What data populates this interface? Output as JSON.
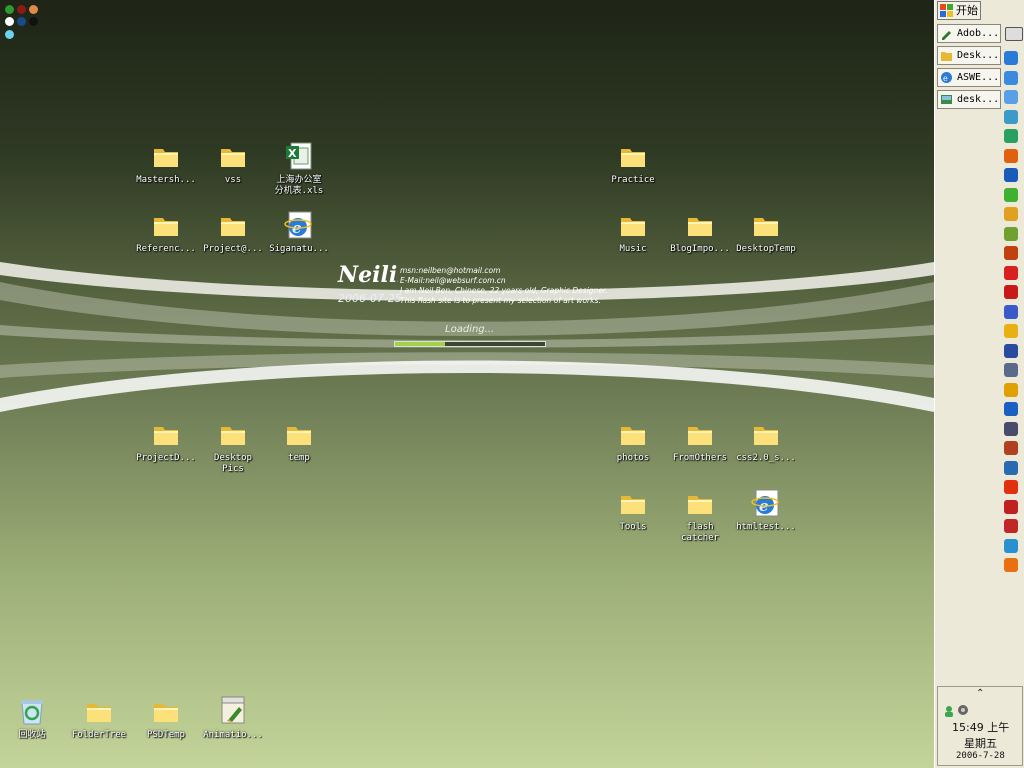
{
  "desktop": {
    "icons": [
      {
        "label": "Mastersh...",
        "type": "folder"
      },
      {
        "label": "vss",
        "type": "folder"
      },
      {
        "label": "上海办公室\n分机表.xls",
        "type": "excel"
      },
      {
        "label": "Practice",
        "type": "folder"
      },
      {
        "label": "Referenc...",
        "type": "folder"
      },
      {
        "label": "Project@...",
        "type": "folder"
      },
      {
        "label": "Siganatu...",
        "type": "ie"
      },
      {
        "label": "Music",
        "type": "folder"
      },
      {
        "label": "BlogImpo...",
        "type": "folder"
      },
      {
        "label": "DesktopTemp",
        "type": "folder"
      },
      {
        "label": "ProjectD...",
        "type": "folder"
      },
      {
        "label": "Desktop\nPics",
        "type": "folder"
      },
      {
        "label": "temp",
        "type": "folder"
      },
      {
        "label": "photos",
        "type": "folder"
      },
      {
        "label": "FromOthers",
        "type": "folder"
      },
      {
        "label": "css2.0_s...",
        "type": "folder"
      },
      {
        "label": "Tools",
        "type": "folder"
      },
      {
        "label": "flash\ncatcher",
        "type": "folder"
      },
      {
        "label": "htmltest...",
        "type": "ie"
      },
      {
        "label": "回收站",
        "type": "recycle"
      },
      {
        "label": "FolderTree",
        "type": "folder"
      },
      {
        "label": "PSDTemp",
        "type": "folder"
      },
      {
        "label": "Animatio...",
        "type": "animation"
      }
    ]
  },
  "color_dots": [
    "#2e9a2e",
    "#8b1a1a",
    "#e08a4a",
    "#ffffff",
    "#1a4a8a",
    "#111111",
    "#6ad4f0"
  ],
  "flash_widget": {
    "logo": "Neilib",
    "date": "2006-07-25",
    "info_lines": [
      "msn:neilben@hotmail.com",
      "E-Mail:neil@websurf.com.cn",
      "I am Neil Ben, Chinese, 22 years old, Graphic Designer.",
      "This flash site is to present my selection of art works."
    ],
    "loading_text": "Loading...",
    "progress": 0.33
  },
  "taskbar": {
    "start_label": "开始",
    "tasks": [
      {
        "label": "Adob...",
        "icon": "pencil-icon"
      },
      {
        "label": "Desk...",
        "icon": "folder-icon"
      },
      {
        "label": "ASWE...",
        "icon": "ie-icon"
      },
      {
        "label": "desk...",
        "icon": "image-icon"
      }
    ],
    "quick_launch_colors": [
      "#2a7ad8",
      "#3a8ae0",
      "#5aa0e8",
      "#3c9ac8",
      "#2aa060",
      "#e06010",
      "#1a5ab8",
      "#40b030",
      "#e0a020",
      "#70a030",
      "#c04010",
      "#d82020",
      "#c81818",
      "#3a5ac8",
      "#e8b010",
      "#2a4aa0",
      "#5a6a8a",
      "#e0a000",
      "#1a60c0",
      "#4a4a6a",
      "#b04020",
      "#2a6ab0",
      "#e03010",
      "#c02020",
      "#c02828",
      "#2a90d0",
      "#e87010"
    ],
    "tray": {
      "time": "15:49 上午",
      "weekday": "星期五",
      "date": "2006-7-28"
    }
  }
}
